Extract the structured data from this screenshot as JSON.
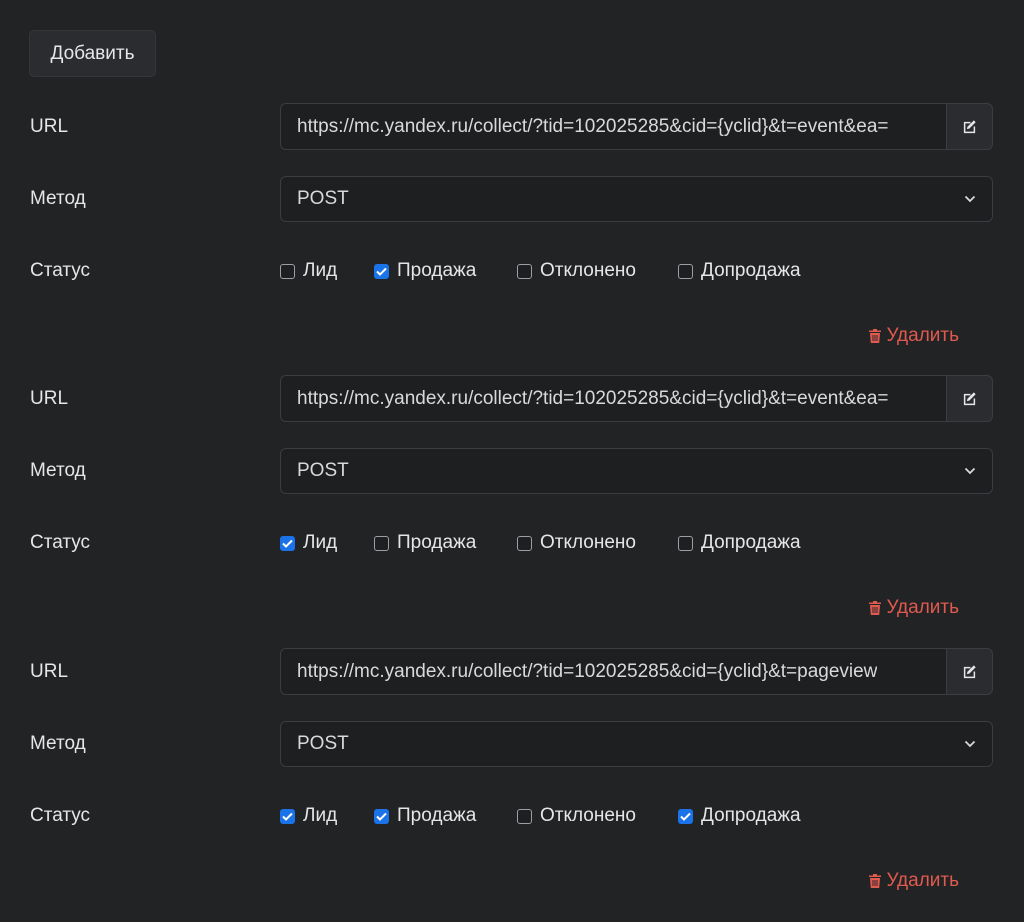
{
  "toolbar": {
    "add_label": "Добавить"
  },
  "labels": {
    "url": "URL",
    "method": "Метод",
    "status": "Статус",
    "delete": "Удалить"
  },
  "status_options": [
    "Лид",
    "Продажа",
    "Отклонено",
    "Допродажа"
  ],
  "rules": [
    {
      "url": "https://mc.yandex.ru/collect/?tid=102025285&cid={yclid}&t=event&ea=",
      "method": "POST",
      "checked": [
        false,
        true,
        false,
        false
      ]
    },
    {
      "url": "https://mc.yandex.ru/collect/?tid=102025285&cid={yclid}&t=event&ea=",
      "method": "POST",
      "checked": [
        true,
        false,
        false,
        false
      ]
    },
    {
      "url": "https://mc.yandex.ru/collect/?tid=102025285&cid={yclid}&t=pageview",
      "method": "POST",
      "checked": [
        true,
        true,
        false,
        true
      ]
    }
  ],
  "colors": {
    "background": "#212325",
    "checkbox_checked": "#1a73e8",
    "delete": "#e05a4f"
  },
  "icons": {
    "edit": "edit-icon",
    "delete": "trash-icon",
    "select": "chevron-down-icon",
    "check": "check-icon"
  }
}
